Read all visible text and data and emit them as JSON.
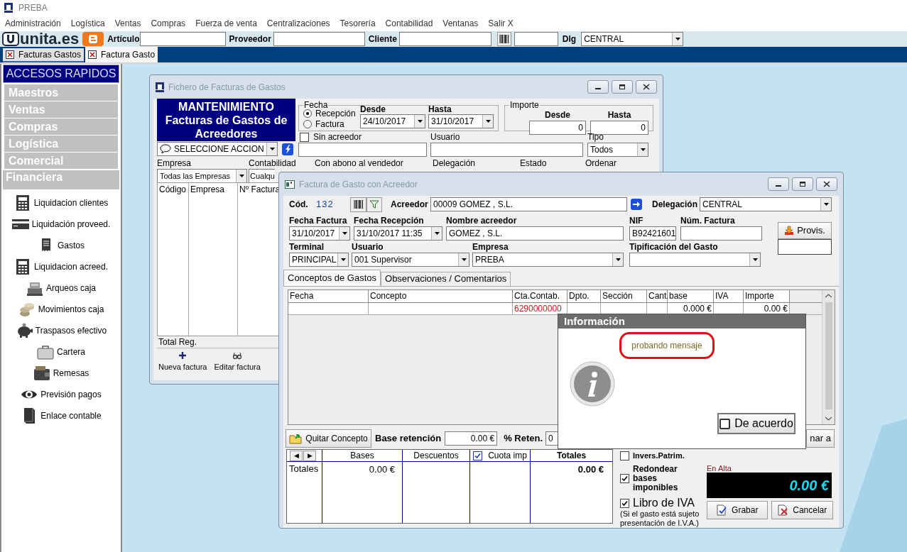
{
  "app": {
    "title": "PREBA"
  },
  "menu": [
    "Administración",
    "Logística",
    "Ventas",
    "Compras",
    "Fuerza de venta",
    "Centralizaciones",
    "Tesorería",
    "Contabilidad",
    "Ventanas",
    "Salir X"
  ],
  "toolbar": {
    "logo": "unita.es",
    "articulo_label": "Artículo",
    "proveedor_label": "Proveedor",
    "cliente_label": "Cliente",
    "dlg_label": "Dlg",
    "dlg_value": "CENTRAL"
  },
  "tabs": [
    {
      "label": "Facturas Gastos",
      "selected": false
    },
    {
      "label": "Factura Gasto",
      "selected": true
    }
  ],
  "sidebar": {
    "title": "ACCESOS RAPIDOS",
    "sections": [
      {
        "label": "Maestros",
        "expanded": false
      },
      {
        "label": "Ventas",
        "expanded": false
      },
      {
        "label": "Compras",
        "expanded": false
      },
      {
        "label": "Logística",
        "expanded": false
      },
      {
        "label": "Comercial",
        "expanded": false
      },
      {
        "label": "Financiera",
        "expanded": true
      }
    ],
    "items": [
      "Liquidacion clientes",
      "Liquidación proveed.",
      "Gastos",
      "Liquidacion acreed.",
      "Arqueos caja",
      "Movimientos caja",
      "Traspasos efectivo",
      "Cartera",
      "Remesas",
      "Previsión pagos",
      "Enlace contable"
    ]
  },
  "list_window": {
    "title": "Fichero de Facturas de Gastos",
    "banner": [
      "MANTENIMIENTO",
      "Facturas de Gastos de",
      "Acreedores"
    ],
    "fecha": {
      "label": "Fecha",
      "options": [
        {
          "label": "Recepción",
          "selected": true
        },
        {
          "label": "Factura",
          "selected": false
        }
      ],
      "desde_label": "Desde",
      "desde": "24/10/2017",
      "hasta_label": "Hasta",
      "hasta": "31/10/2017"
    },
    "importe": {
      "label": "Importe",
      "desde_label": "Desde",
      "desde": "0",
      "hasta_label": "Hasta",
      "hasta": "0"
    },
    "sin_acreedor": {
      "label": "Sin acreedor",
      "checked": false
    },
    "usuario_label": "Usuario",
    "tipo": {
      "label": "Tipo",
      "value": "Todos"
    },
    "action": "SELECCIONE ACCION",
    "filters": [
      {
        "label": "Empresa",
        "value": "Todas las Empresas"
      },
      {
        "label": "Contabilidad",
        "value": "Cualqu"
      },
      {
        "label": "Con abono al vendedor"
      },
      {
        "label": "Delegación"
      },
      {
        "label": "Estado"
      },
      {
        "label": "Ordenar"
      }
    ],
    "columns": [
      "Código",
      "Empresa",
      "Nº Factura"
    ],
    "footer": "Total Reg.",
    "buttons": [
      "Nueva factura",
      "Editar factura"
    ]
  },
  "invoice_window": {
    "title": "Factura de Gasto con Acreedor",
    "cod_label": "Cód.",
    "cod": "132",
    "acreedor_label": "Acreedor",
    "acreedor": "00009 GOMEZ , S.L.",
    "delegacion_label": "Delegación",
    "delegacion": "CENTRAL",
    "fecha_factura_label": "Fecha Factura",
    "fecha_factura": "31/10/2017",
    "fecha_recepcion_label": "Fecha Recepción",
    "fecha_recepcion": "31/10/2017 11:35",
    "nombre_label": "Nombre acreedor",
    "nombre": "GOMEZ , S.L.",
    "nif_label": "NIF",
    "nif": "B92421601",
    "num_factura_label": "Núm. Factura",
    "provis": "Provis.",
    "terminal_label": "Terminal",
    "terminal": "PRINCIPAL",
    "usuario_label": "Usuario",
    "usuario": "001 Supervisor",
    "empresa_label": "Empresa",
    "empresa": "PREBA",
    "tipificacion_label": "Tipificación del Gasto",
    "tabs": [
      {
        "label": "Conceptos de Gastos",
        "selected": true
      },
      {
        "label": "Observaciones / Comentarios",
        "selected": false
      }
    ],
    "columns": [
      "Fecha",
      "Concepto",
      "Cta.Contab.",
      "Dpto.",
      "Sección",
      "Cant.",
      "base",
      "IVA",
      "Importe"
    ],
    "row": {
      "cta": "6290000000",
      "base": "0.000 €",
      "importe": "0.00 €"
    },
    "quitar": "Quitar Concepto",
    "base_retencion_label": "Base retención",
    "base_retencion": "0.00 €",
    "reten_label": "% Reten.",
    "reten": "0",
    "partial_button": "nar a",
    "totals": {
      "nav": [
        "◀",
        "▶"
      ],
      "columns": [
        {
          "label": "Bases"
        },
        {
          "label": "Descuentos"
        },
        {
          "label": "Cuota imp",
          "checked": true
        },
        {
          "label": "Totales"
        }
      ],
      "row_label": "Totales",
      "bases": "0.00 €",
      "totales": "0.00 €"
    },
    "options": [
      {
        "label": "Invers.Patrim.",
        "checked": false
      },
      {
        "label": "Redondear bases imponibles",
        "checked": true
      },
      {
        "label": "Libro de IVA",
        "checked": true
      }
    ],
    "note": "(Si el gasto está sujeto presentación de I.V.A.)",
    "status": "En Alta",
    "total": "0.00 €",
    "buttons": [
      "Grabar",
      "Cancelar"
    ]
  },
  "dialog": {
    "title": "Información",
    "message": "probando mensaje",
    "button": "De acuerdo"
  }
}
